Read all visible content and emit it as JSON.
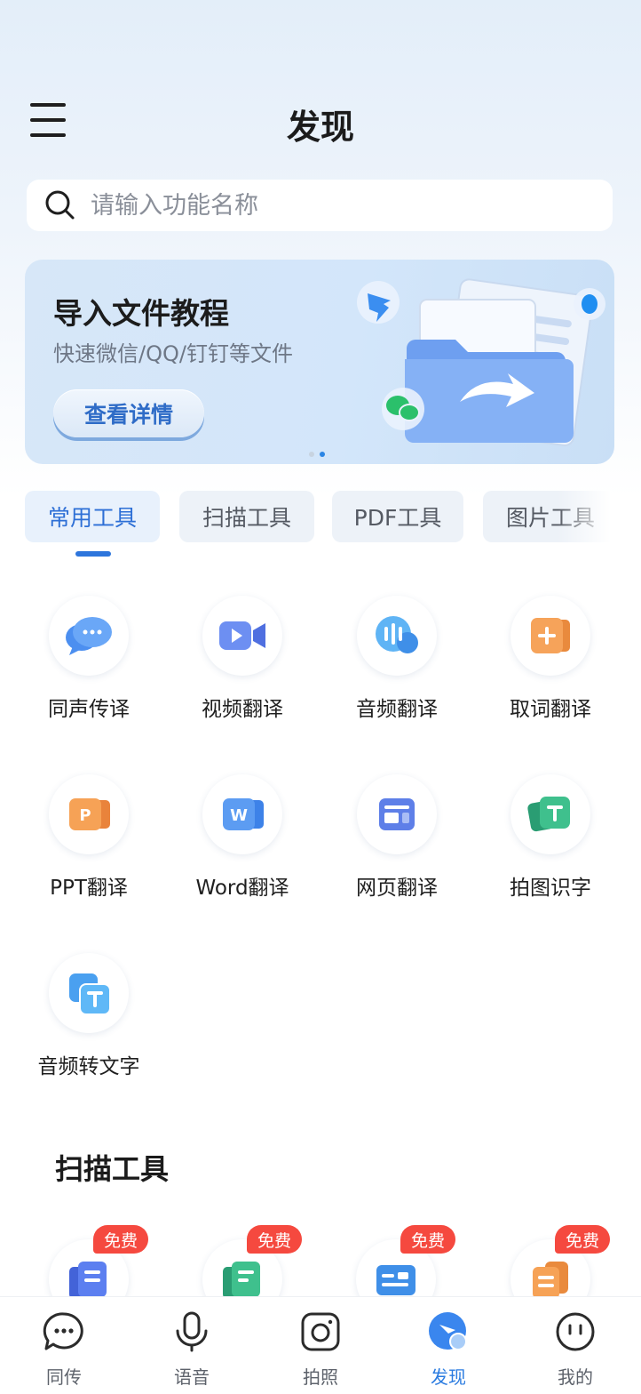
{
  "header": {
    "title": "发现"
  },
  "search": {
    "placeholder": "请输入功能名称",
    "value": ""
  },
  "banner": {
    "title": "导入文件教程",
    "subtitle": "快速微信/QQ/钉钉等文件",
    "button_label": "查看详情",
    "page_count": 2,
    "active_page": 2
  },
  "tabs": [
    {
      "label": "常用工具",
      "active": true
    },
    {
      "label": "扫描工具",
      "active": false
    },
    {
      "label": "PDF工具",
      "active": false
    },
    {
      "label": "图片工具",
      "active": false
    }
  ],
  "tools": [
    {
      "label": "同声传译",
      "icon": "chat-bubbles-icon"
    },
    {
      "label": "视频翻译",
      "icon": "video-camera-icon"
    },
    {
      "label": "音频翻译",
      "icon": "audio-wave-icon"
    },
    {
      "label": "取词翻译",
      "icon": "plus-card-icon"
    },
    {
      "label": "PPT翻译",
      "icon": "ppt-file-icon"
    },
    {
      "label": "Word翻译",
      "icon": "word-file-icon"
    },
    {
      "label": "网页翻译",
      "icon": "webpage-icon"
    },
    {
      "label": "拍图识字",
      "icon": "text-scan-icon"
    },
    {
      "label": "音频转文字",
      "icon": "audio-to-text-icon"
    }
  ],
  "scan_section": {
    "title": "扫描工具",
    "badge": "免费",
    "items": [
      {
        "icon": "document-scan-icon"
      },
      {
        "icon": "certificate-scan-icon"
      },
      {
        "icon": "id-card-scan-icon"
      },
      {
        "icon": "receipt-scan-icon"
      }
    ]
  },
  "bottom_nav": [
    {
      "label": "同传",
      "icon": "chat-icon",
      "active": false
    },
    {
      "label": "语音",
      "icon": "microphone-icon",
      "active": false
    },
    {
      "label": "拍照",
      "icon": "camera-icon",
      "active": false
    },
    {
      "label": "发现",
      "icon": "discover-icon",
      "active": true
    },
    {
      "label": "我的",
      "icon": "profile-face-icon",
      "active": false
    }
  ],
  "colors": {
    "accent": "#2d75dc",
    "badge": "#f5493f",
    "background_top": "#e3eef9"
  }
}
